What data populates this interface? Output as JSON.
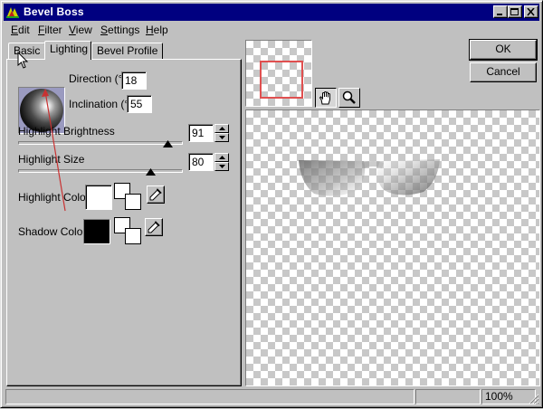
{
  "window": {
    "title": "Bevel Boss",
    "title_bar_color": "#000080",
    "app_icon": "bevel-boss-app-icon"
  },
  "menu": {
    "items": [
      {
        "label": "Edit",
        "accel": "E",
        "rest": "dit"
      },
      {
        "label": "Filter",
        "accel": "F",
        "rest": "ilter"
      },
      {
        "label": "View",
        "accel": "V",
        "rest": "iew"
      },
      {
        "label": "Settings",
        "accel": "S",
        "rest": "ettings"
      },
      {
        "label": "Help",
        "accel": "H",
        "rest": "elp"
      }
    ]
  },
  "tabs": [
    {
      "label": "Basic",
      "active": false
    },
    {
      "label": "Lighting",
      "active": true
    },
    {
      "label": "Bevel Profile",
      "active": false
    }
  ],
  "lighting": {
    "direction_label": "Direction (°)",
    "direction_value": "18",
    "inclination_label": "Inclination (°)",
    "inclination_value": "55",
    "highlight_brightness_label": "Highlight Brightness",
    "highlight_brightness_value": "91",
    "highlight_size_label": "Highlight Size",
    "highlight_size_value": "80",
    "highlight_color_label": "Highlight Color",
    "highlight_color": "#ffffff",
    "shadow_color_label": "Shadow Color",
    "shadow_color": "#000000"
  },
  "buttons": {
    "ok": "OK",
    "cancel": "Cancel"
  },
  "tools": {
    "pan": "hand-icon",
    "zoom": "magnifier-icon"
  },
  "status": {
    "zoom": "100%"
  },
  "colors": {
    "face": "#c0c0c0",
    "view_rect": "#e05050",
    "annotation_arrow": "#c83232"
  }
}
